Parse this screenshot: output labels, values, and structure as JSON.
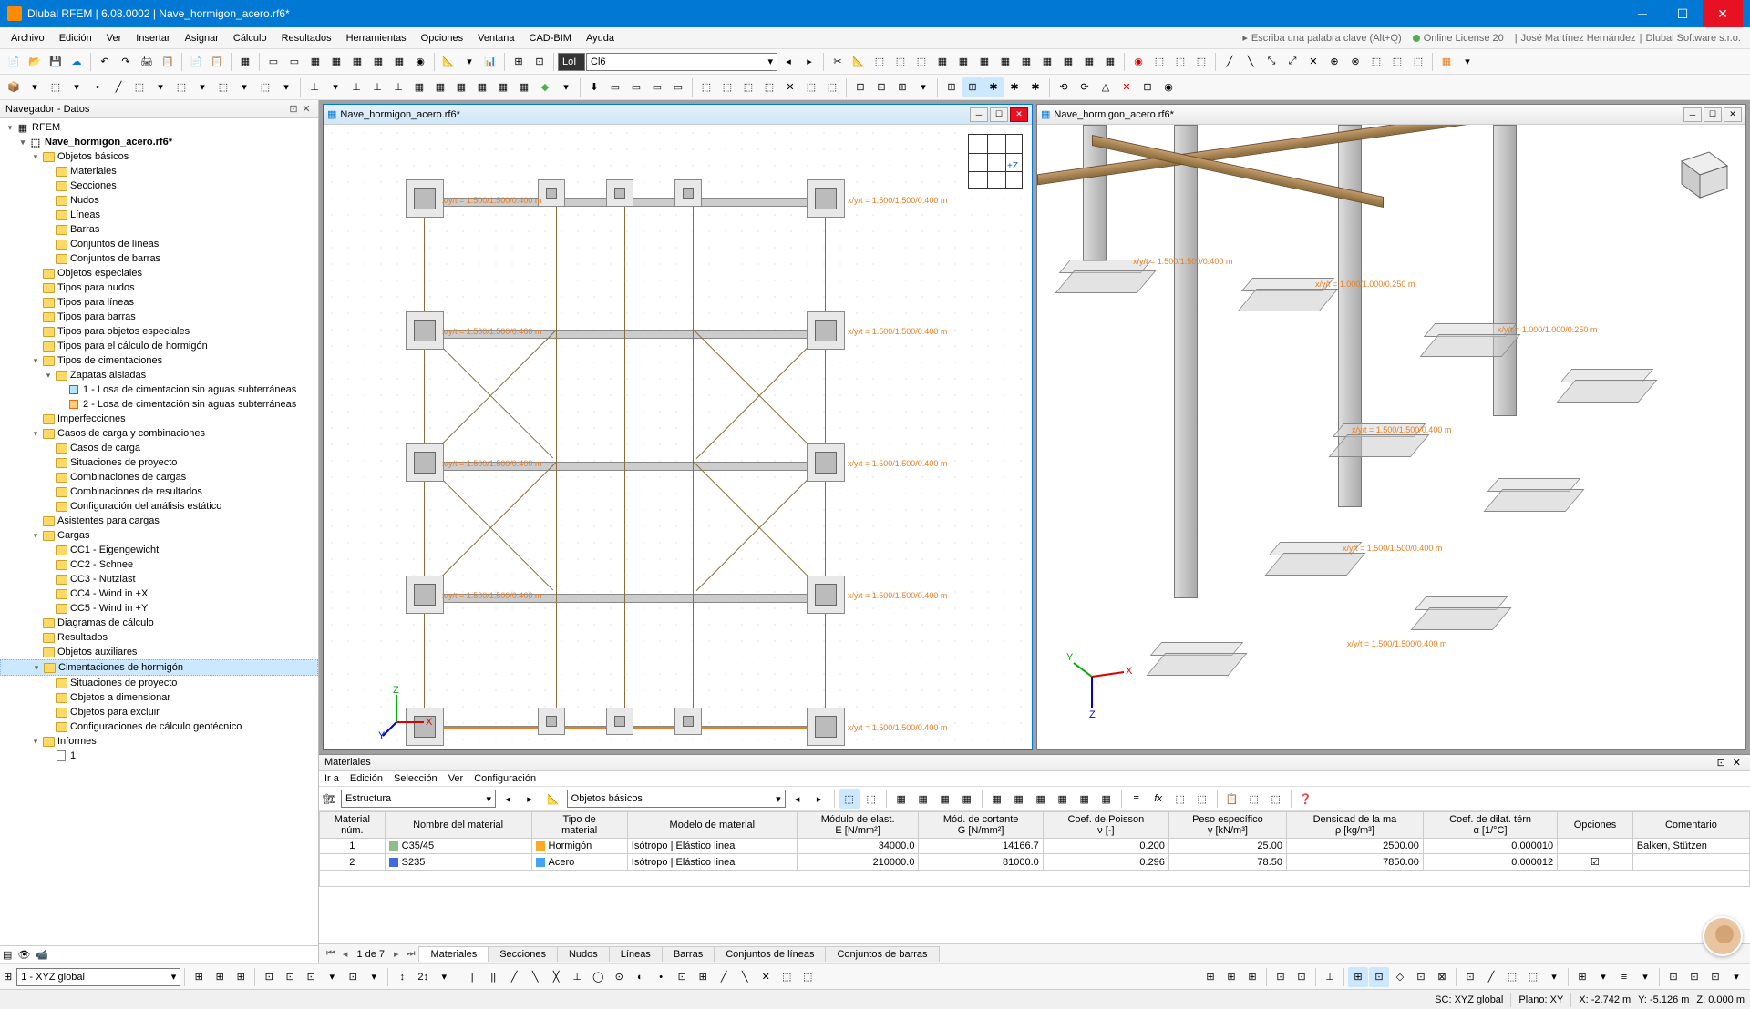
{
  "app": {
    "title": "Dlubal RFEM | 6.08.0002 | Nave_hormigon_acero.rf6*",
    "search_placeholder": "Escriba una palabra clave (Alt+Q)",
    "license": "Online License 20",
    "user": "José Martínez Hernández",
    "company": "Dlubal Software s.r.o."
  },
  "menu": [
    "Archivo",
    "Edición",
    "Ver",
    "Insertar",
    "Asignar",
    "Cálculo",
    "Resultados",
    "Herramientas",
    "Opciones",
    "Ventana",
    "CAD-BIM",
    "Ayuda"
  ],
  "toolbar_combo1": "LoI",
  "toolbar_combo2": "Cl6",
  "nav": {
    "title": "Navegador - Datos",
    "root": "RFEM",
    "model": "Nave_hormigon_acero.rf6*",
    "items": [
      {
        "l": "Objetos básicos",
        "d": 2,
        "exp": true,
        "children": [
          {
            "l": "Materiales",
            "d": 3,
            "ic": "mat"
          },
          {
            "l": "Secciones",
            "d": 3,
            "ic": "sec"
          },
          {
            "l": "Nudos",
            "d": 3,
            "ic": "node"
          },
          {
            "l": "Líneas",
            "d": 3,
            "ic": "line"
          },
          {
            "l": "Barras",
            "d": 3,
            "ic": "bar"
          },
          {
            "l": "Conjuntos de líneas",
            "d": 3,
            "ic": "lset"
          },
          {
            "l": "Conjuntos de barras",
            "d": 3,
            "ic": "bset"
          }
        ]
      },
      {
        "l": "Objetos especiales",
        "d": 2
      },
      {
        "l": "Tipos para nudos",
        "d": 2
      },
      {
        "l": "Tipos para líneas",
        "d": 2
      },
      {
        "l": "Tipos para barras",
        "d": 2
      },
      {
        "l": "Tipos para objetos especiales",
        "d": 2
      },
      {
        "l": "Tipos para el cálculo de hormigón",
        "d": 2
      },
      {
        "l": "Tipos de cimentaciones",
        "d": 2,
        "exp": true,
        "children": [
          {
            "l": "Zapatas aisladas",
            "d": 3,
            "exp": true,
            "ic": "fnd",
            "children": [
              {
                "l": "1 - Losa de cimentacion sin aguas subterráneas",
                "d": 4,
                "ic": "sq1"
              },
              {
                "l": "2 - Losa de cimentación sin aguas subterráneas",
                "d": 4,
                "ic": "sq2"
              }
            ]
          }
        ]
      },
      {
        "l": "Imperfecciones",
        "d": 2
      },
      {
        "l": "Casos de carga y combinaciones",
        "d": 2,
        "exp": true,
        "children": [
          {
            "l": "Casos de carga",
            "d": 3,
            "ic": "lc"
          },
          {
            "l": "Situaciones de proyecto",
            "d": 3,
            "ic": "ds"
          },
          {
            "l": "Combinaciones de cargas",
            "d": 3,
            "ic": "co"
          },
          {
            "l": "Combinaciones de resultados",
            "d": 3,
            "ic": "rc"
          },
          {
            "l": "Configuración del análisis estático",
            "d": 3,
            "ic": "sa"
          }
        ]
      },
      {
        "l": "Asistentes para cargas",
        "d": 2
      },
      {
        "l": "Cargas",
        "d": 2,
        "exp": true,
        "children": [
          {
            "l": "CC1 - Eigengewicht",
            "d": 3
          },
          {
            "l": "CC2 - Schnee",
            "d": 3
          },
          {
            "l": "CC3 - Nutzlast",
            "d": 3
          },
          {
            "l": "CC4 - Wind in +X",
            "d": 3
          },
          {
            "l": "CC5 - Wind in +Y",
            "d": 3
          }
        ]
      },
      {
        "l": "Diagramas de cálculo",
        "d": 2,
        "leaf": true
      },
      {
        "l": "Resultados",
        "d": 2
      },
      {
        "l": "Objetos auxiliares",
        "d": 2
      },
      {
        "l": "Cimentaciones de hormigón",
        "d": 2,
        "exp": true,
        "sel": true,
        "children": [
          {
            "l": "Situaciones de proyecto",
            "d": 3,
            "ic": "ds"
          },
          {
            "l": "Objetos a dimensionar",
            "d": 3,
            "ic": "od"
          },
          {
            "l": "Objetos para excluir",
            "d": 3,
            "ic": "oe"
          },
          {
            "l": "Configuraciones de cálculo geotécnico",
            "d": 3,
            "ic": "gc"
          }
        ]
      },
      {
        "l": "Informes",
        "d": 2,
        "exp": true,
        "children": [
          {
            "l": "1",
            "d": 3,
            "ic": "doc"
          }
        ]
      }
    ]
  },
  "views": {
    "left_title": "Nave_hormigon_acero.rf6*",
    "right_title": "Nave_hormigon_acero.rf6*",
    "dim_label": "x/y/t = 1.500/1.500/0.400 m",
    "dim_label2": "x/y/t = 1.000/1.000/0.250 m",
    "cube_label": "+Z"
  },
  "bottom": {
    "title": "Materiales",
    "menu": [
      "Ir a",
      "Edición",
      "Selección",
      "Ver",
      "Configuración"
    ],
    "combo1": "Estructura",
    "combo2": "Objetos básicos",
    "headers": [
      "Material\nnúm.",
      "Nombre del material",
      "Tipo de\nmaterial",
      "Modelo de material",
      "Módulo de elast.\nE [N/mm²]",
      "Mód. de cortante\nG [N/mm²]",
      "Coef. de Poisson\nν [-]",
      "Peso específico\nγ [kN/m³]",
      "Densidad de la ma\nρ [kg/m³]",
      "Coef. de dilat. térn\nα [1/°C]",
      "Opciones",
      "Comentario"
    ],
    "rows": [
      {
        "n": "1",
        "name": "C35/45",
        "type": "Hormigón",
        "model": "Isótropo | Elástico lineal",
        "e": "34000.0",
        "g": "14166.7",
        "v": "0.200",
        "gamma": "25.00",
        "rho": "2500.00",
        "alpha": "0.000010",
        "opt": "",
        "com": "Balken, Stützen",
        "color": "#8fbc8f"
      },
      {
        "n": "2",
        "name": "S235",
        "type": "Acero",
        "model": "Isótropo | Elástico lineal",
        "e": "210000.0",
        "g": "81000.0",
        "v": "0.296",
        "gamma": "78.50",
        "rho": "7850.00",
        "alpha": "0.000012",
        "opt": "☑",
        "com": "",
        "color": "#4169e1"
      }
    ],
    "pager": "1 de 7",
    "tabs": [
      "Materiales",
      "Secciones",
      "Nudos",
      "Líneas",
      "Barras",
      "Conjuntos de líneas",
      "Conjuntos de barras"
    ]
  },
  "status": {
    "cs": "1 - XYZ global",
    "sc": "SC: XYZ global",
    "plane": "Plano:  XY",
    "x": "X: -2.742 m",
    "y": "Y: -5.126 m",
    "z": "Z: 0.000 m"
  }
}
